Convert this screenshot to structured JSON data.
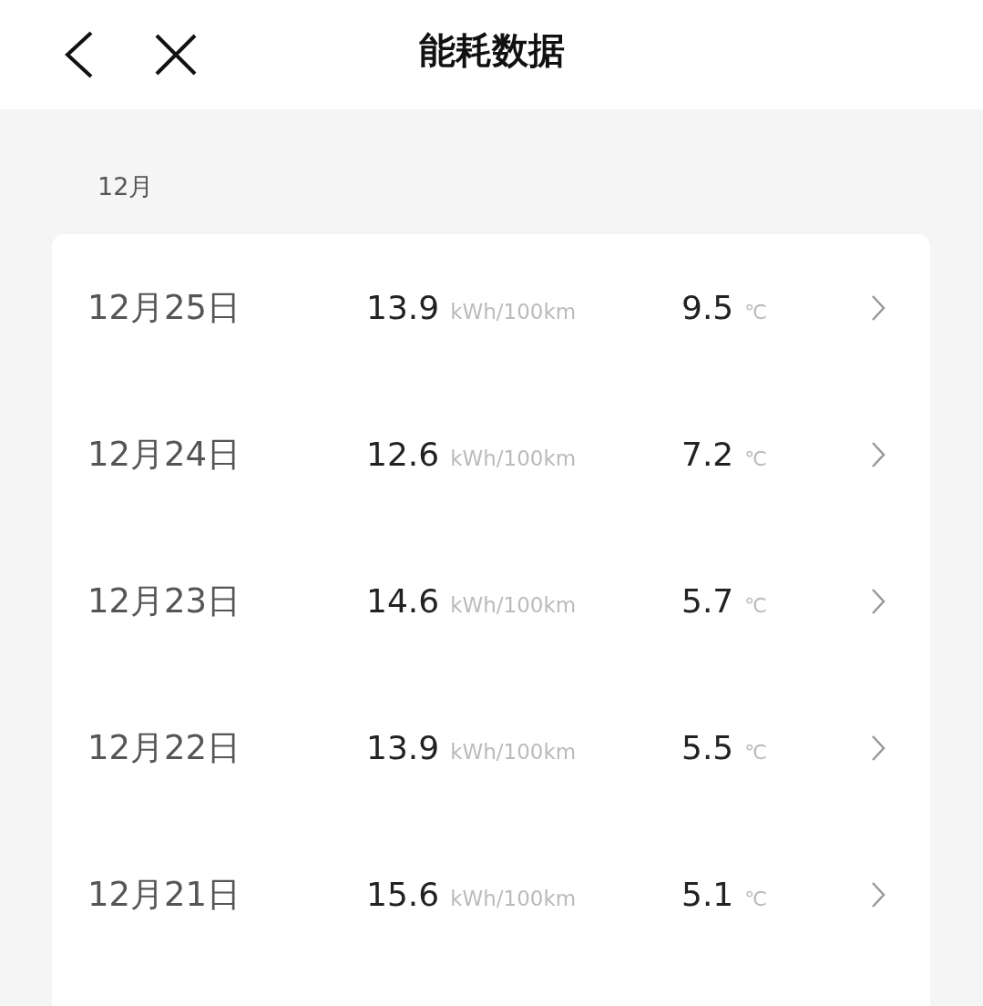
{
  "header": {
    "title": "能耗数据"
  },
  "section": {
    "label": "12月"
  },
  "rows": [
    {
      "date": "12月25日",
      "consumption": "13.9",
      "consumption_unit": "kWh/100km",
      "temperature": "9.5",
      "temperature_unit": "℃"
    },
    {
      "date": "12月24日",
      "consumption": "12.6",
      "consumption_unit": "kWh/100km",
      "temperature": "7.2",
      "temperature_unit": "℃"
    },
    {
      "date": "12月23日",
      "consumption": "14.6",
      "consumption_unit": "kWh/100km",
      "temperature": "5.7",
      "temperature_unit": "℃"
    },
    {
      "date": "12月22日",
      "consumption": "13.9",
      "consumption_unit": "kWh/100km",
      "temperature": "5.5",
      "temperature_unit": "℃"
    },
    {
      "date": "12月21日",
      "consumption": "15.6",
      "consumption_unit": "kWh/100km",
      "temperature": "5.1",
      "temperature_unit": "℃"
    }
  ]
}
